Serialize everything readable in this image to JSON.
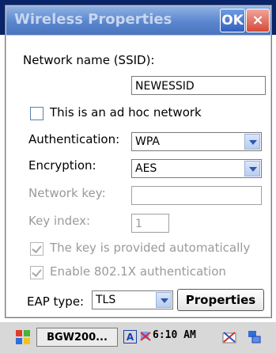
{
  "window": {
    "title": "Wireless Properties",
    "ok_label": "OK",
    "close_label": "×"
  },
  "form": {
    "ssid_label": "Network name (SSID):",
    "ssid_value": "NEWESSID",
    "adhoc_label": "This is an ad hoc network",
    "auth_label": "Authentication:",
    "auth_value": "WPA",
    "enc_label": "Encryption:",
    "enc_value": "AES",
    "netkey_label": "Network key:",
    "netkey_value": "",
    "keyindex_label": "Key index:",
    "keyindex_value": "1",
    "autokey_label": "The key is provided automatically",
    "dot1x_label": "Enable 802.1X authentication",
    "eap_label": "EAP type:",
    "eap_value": "TLS",
    "properties_label": "Properties"
  },
  "taskbar": {
    "app_label": "BGW200...",
    "tray_a": "A",
    "clock": "6:10 AM"
  },
  "colors": {
    "titlebar": "#5a86cf",
    "ok_button": "#3360c0",
    "close_button": "#d44a38",
    "disabled_text": "#9a9a9a"
  }
}
